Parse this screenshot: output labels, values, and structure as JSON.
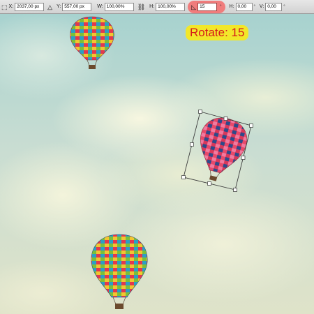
{
  "options_bar": {
    "x_label": "X:",
    "x_value": "2037,00 px",
    "y_label": "Y:",
    "y_value": "557,00 px",
    "w_label": "W:",
    "w_value": "100,00%",
    "h_label": "H:",
    "h_value": "100,00%",
    "rotate_value": "15",
    "rotate_unit": "°",
    "h_skew_label": "H:",
    "h_skew_value": "0,00",
    "h_skew_unit": "°",
    "v_skew_label": "V:",
    "v_skew_value": "0,00",
    "v_skew_unit": "°"
  },
  "annotation": {
    "rotate_label": "Rotate: 15"
  },
  "icons": [
    "reference-point-icon",
    "delta-icon",
    "link-icon",
    "rotate-angle-icon"
  ],
  "colors": {
    "annotation_bg": "#f2e72a",
    "annotation_text": "#d61a1a",
    "rotate_highlight": "#f07c7c"
  }
}
